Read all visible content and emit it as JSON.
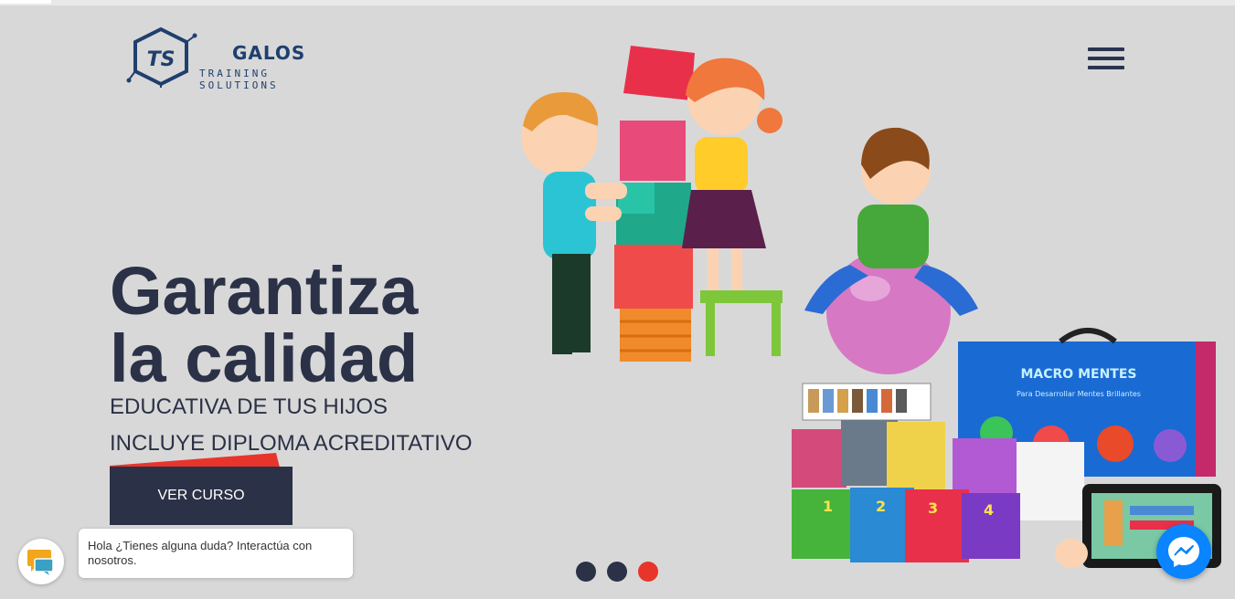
{
  "brand": {
    "name": "GALOS",
    "tagline": "TRAINING SOLUTIONS",
    "monogram": "TS"
  },
  "header": {
    "menu_icon": "hamburger-menu-icon"
  },
  "hero": {
    "title_line1": "Garantiza",
    "title_line2": "la calidad",
    "subtitle": "EDUCATIVA DE TUS HIJOS",
    "diploma": "INCLUYE DIPLOMA ACREDITATIVO",
    "cta_label": "VER CURSO"
  },
  "product": {
    "box_title": "MACRO MENTES",
    "box_subtitle": "Para Desarrollar Mentes Brillantes",
    "book_numbers": [
      "1",
      "2",
      "3",
      "4"
    ]
  },
  "slider": {
    "slides": 3,
    "active_index": 2
  },
  "chat": {
    "message": "Hola ¿Tienes alguna duda? Interactúa con nosotros."
  },
  "colors": {
    "background": "#d8d8d8",
    "navy": "#2b3146",
    "accent_red": "#e8352b",
    "logo_blue": "#1f3f6e",
    "messenger_blue": "#0a84ff"
  }
}
